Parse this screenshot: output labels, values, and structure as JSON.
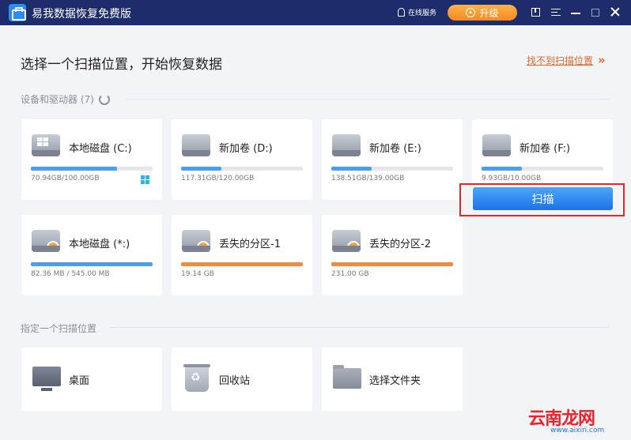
{
  "titlebar": {
    "app_title": "易我数据恢复免费版",
    "service_label": "在线服务",
    "upgrade_label": "升级"
  },
  "header": {
    "title": "选择一个扫描位置，开始恢复数据",
    "not_found_link": "找不到扫描位置",
    "not_found_arrow": "»"
  },
  "devices": {
    "section_label": "设备和驱动器 (7)",
    "drives": [
      {
        "name": "本地磁盘 (C:)",
        "capacity": "70.94GB/100.00GB",
        "used_fraction": 0.71,
        "bar_color": "#4b9df0",
        "system": true,
        "lost": false
      },
      {
        "name": "新加卷 (D:)",
        "capacity": "117.31GB/120.00GB",
        "used_fraction": 0.33,
        "bar_color": "#4b9df0",
        "system": false,
        "lost": false
      },
      {
        "name": "新加卷 (E:)",
        "capacity": "138.51GB/139.00GB",
        "used_fraction": 0.33,
        "bar_color": "#4b9df0",
        "system": false,
        "lost": false
      },
      {
        "name": "新加卷 (F:)",
        "capacity": "9.93GB/10.00GB",
        "used_fraction": 0.33,
        "bar_color": "#4b9df0",
        "system": false,
        "lost": false
      },
      {
        "name": "本地磁盘 (*:)",
        "capacity": "82.36 MB / 545.00 MB",
        "used_fraction": 1.0,
        "bar_color": "#4b9df0",
        "system": false,
        "lost": true
      },
      {
        "name": "丢失的分区-1",
        "capacity": "19.14 GB",
        "used_fraction": 1.0,
        "bar_color": "#f08a3c",
        "system": false,
        "lost": true
      },
      {
        "name": "丢失的分区-2",
        "capacity": "231.00 GB",
        "used_fraction": 1.0,
        "bar_color": "#f08a3c",
        "system": false,
        "lost": true
      }
    ],
    "scan_label": "扫描"
  },
  "locations": {
    "section_label": "指定一个扫描位置",
    "items": [
      {
        "name": "桌面",
        "icon": "desktop-icon"
      },
      {
        "name": "回收站",
        "icon": "recycle-bin-icon"
      },
      {
        "name": "选择文件夹",
        "icon": "folder-icon"
      }
    ]
  },
  "watermark": {
    "text": "云南龙网",
    "url": "www.aixiri.com"
  }
}
